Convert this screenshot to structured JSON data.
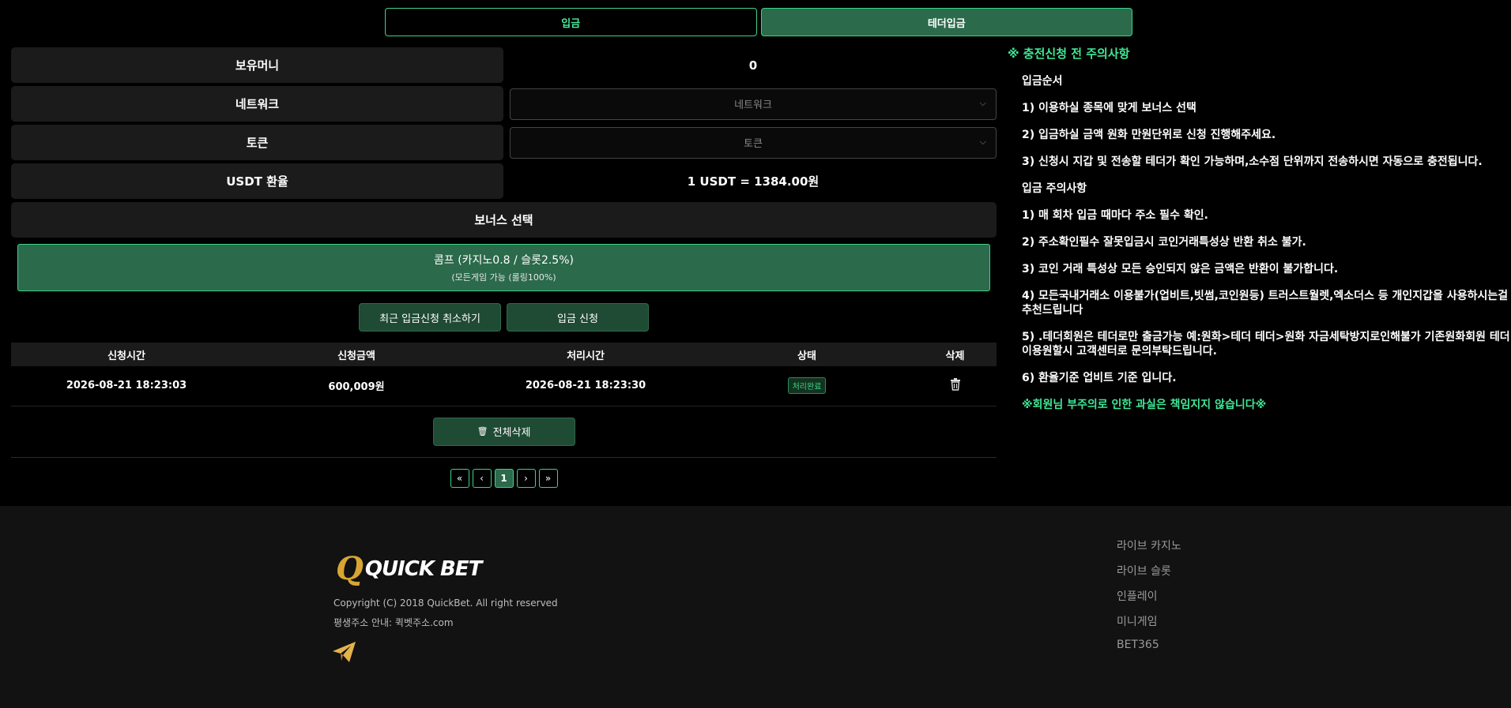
{
  "tabs": [
    {
      "label": "입금"
    },
    {
      "label": "테더입금"
    }
  ],
  "form": {
    "balance_label": "보유머니",
    "balance_value": "0",
    "network_label": "네트워크",
    "network_placeholder": "네트워크",
    "token_label": "토큰",
    "token_placeholder": "토큰",
    "rate_label": "USDT 환율",
    "rate_value": "1 USDT = 1384.00원"
  },
  "bonus": {
    "heading": "보너스 선택",
    "option_title": "콤프 (카지노0.8 / 슬롯2.5%)",
    "option_sub": "(모든게임 가능 (롤링100%)"
  },
  "actions": {
    "cancel_recent": "최근 입금신청 취소하기",
    "apply": "입금 신청"
  },
  "table": {
    "headers": [
      "신청시간",
      "신청금액",
      "처리시간",
      "상태",
      "삭제"
    ],
    "rows": [
      {
        "requested": "2026-08-21 18:23:03",
        "amount": "600,009원",
        "processed": "2026-08-21 18:23:30",
        "status": "처리완료"
      }
    ]
  },
  "delete_all": "전체삭제",
  "pagination": {
    "first": "«",
    "prev": "‹",
    "current": "1",
    "next": "›",
    "last": "»"
  },
  "notice": {
    "title": "※ 충전신청 전 주의사항",
    "lines": [
      "입금순서",
      "1) 이용하실 종목에 맞게 보너스 선택",
      "2) 입금하실 금액 원화 만원단위로 신청 진행해주세요.",
      "3) 신청시 지갑 및 전송할 테더가 확인 가능하며,소수점 단위까지 전송하시면 자동으로 충전됩니다.",
      "입금 주의사항",
      "1) 매 회차 입금 때마다 주소 필수 확인.",
      "2) 주소확인필수 잘못입금시 코인거래특성상 반환 취소 불가.",
      "3) 코인 거래 특성상 모든 승인되지 않은 금액은 반환이 불가합니다.",
      "4) 모든국내거래소 이용불가(업비트,빗썸,코인원등) 트러스트월렛,엑소더스 등 개인지갑을 사용하시는걸 추천드립니다",
      "5) .테더회원은 테더로만 출금가능 예:원화>테더 테더>원화 자금세탁방지로인해불가 기존원화회원 테더이용원할시 고객센터로 문의부탁드립니다.",
      "6) 환율기준 업비트 기준 입니다."
    ],
    "warning": "※회원님 부주의로 인한 과실은 책임지지 않습니다※"
  },
  "footer": {
    "logo_text": "QUICK BET",
    "copyright": "Copyright (C) 2018 QuickBet. All right reserved",
    "address": "평생주소 안내: 퀵벳주소.com",
    "links": [
      "라이브 카지노",
      "라이브 슬롯",
      "인플레이",
      "미니게임",
      "BET365"
    ]
  },
  "colors": {
    "accent": "#3fd28a",
    "accent_fill": "#2b6a4a",
    "panel": "#1b1b1b",
    "footer_bg": "#121212"
  }
}
